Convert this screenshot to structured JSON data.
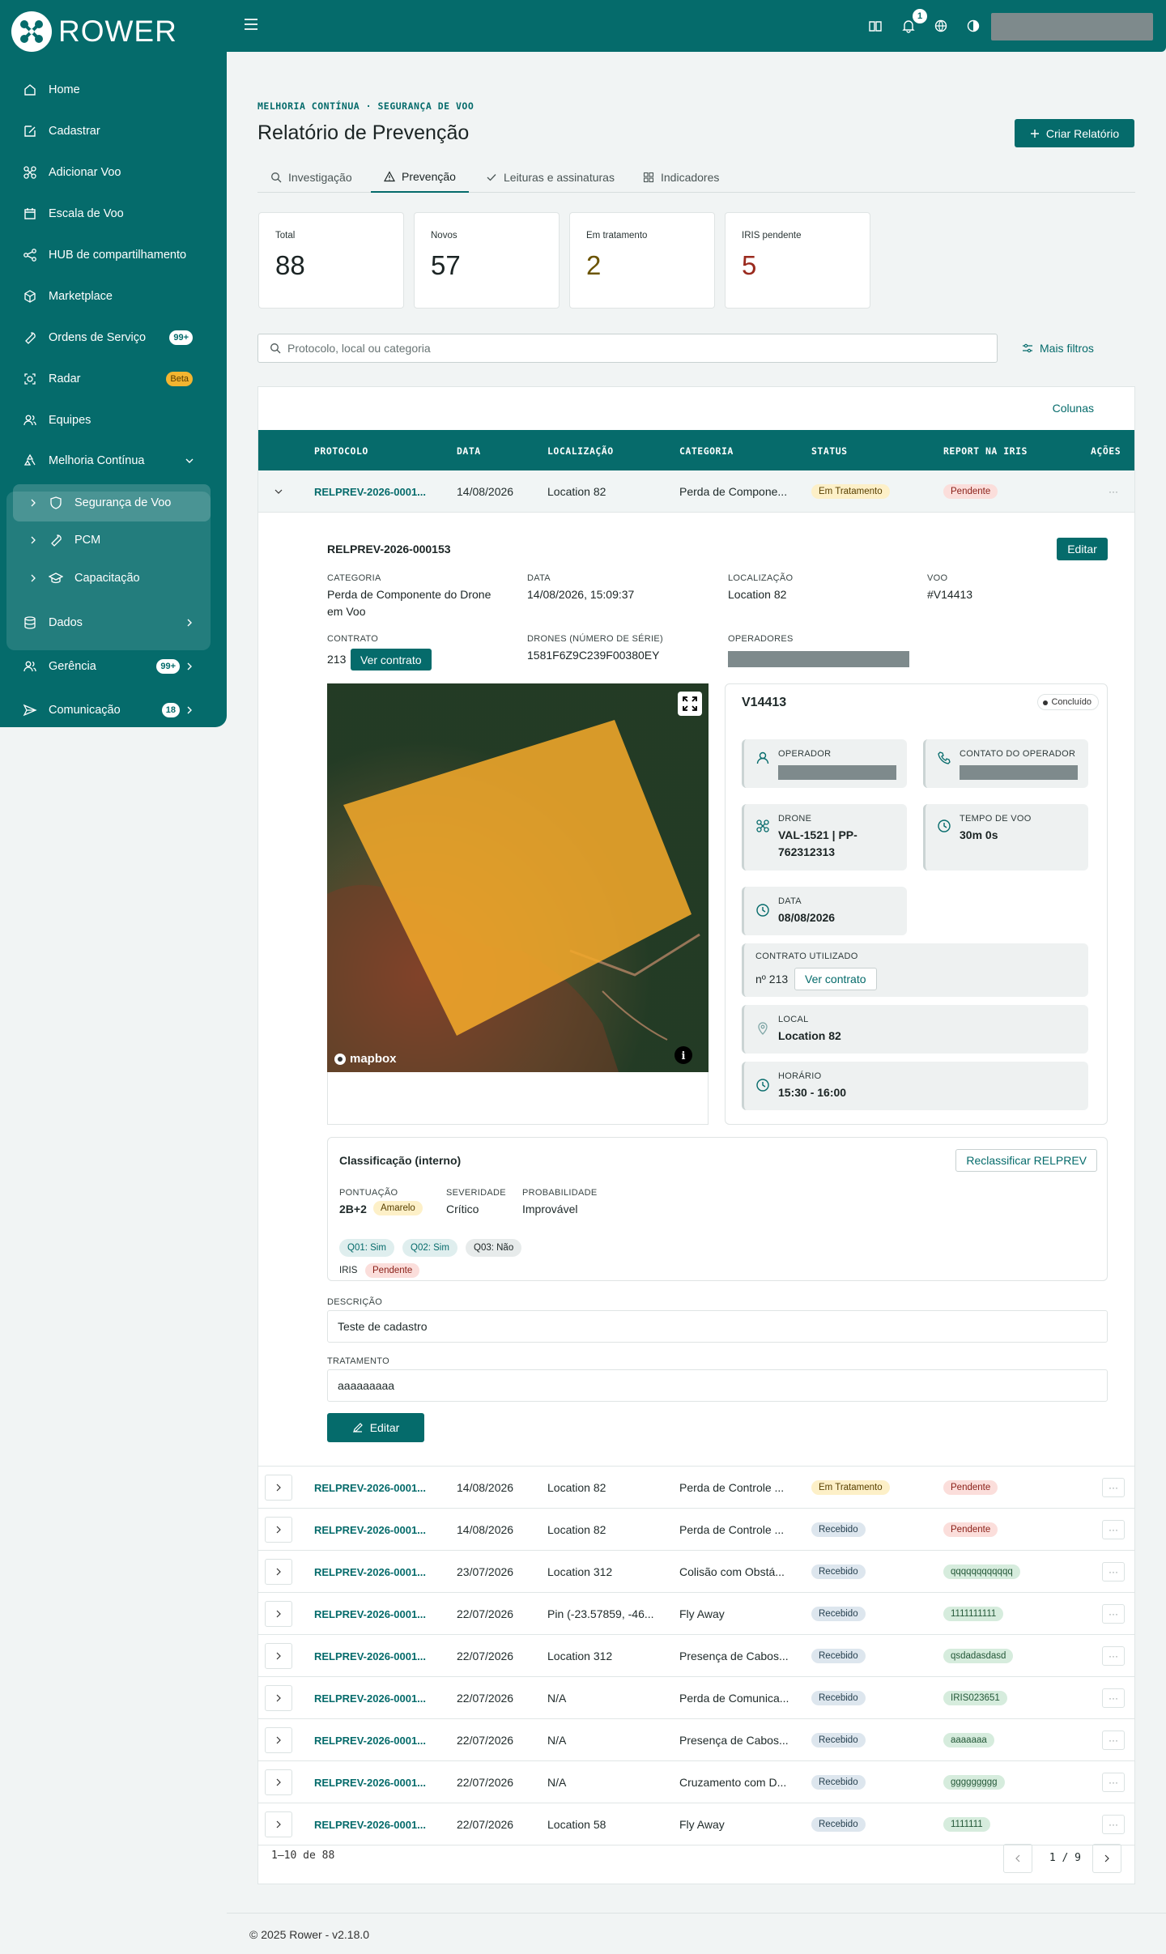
{
  "app": {
    "logo_text": "ROWER",
    "notifications_count": "1"
  },
  "sidebar": {
    "items": [
      {
        "label": "Home"
      },
      {
        "label": "Cadastrar"
      },
      {
        "label": "Adicionar Voo"
      },
      {
        "label": "Escala de Voo"
      },
      {
        "label": "HUB de compartilhamento"
      },
      {
        "label": "Marketplace"
      },
      {
        "label": "Ordens de Serviço",
        "badge": "99+"
      },
      {
        "label": "Radar",
        "badge": "Beta"
      },
      {
        "label": "Equipes"
      },
      {
        "label": "Melhoria Contínua"
      },
      {
        "label": "Dados"
      },
      {
        "label": "Gerência",
        "badge": "99+"
      },
      {
        "label": "Comunicação",
        "badge": "18"
      }
    ],
    "sub_items": [
      {
        "label": "Segurança de Voo"
      },
      {
        "label": "PCM"
      },
      {
        "label": "Capacitação"
      }
    ]
  },
  "header": {
    "breadcrumb": "MELHORIA CONTÍNUA · SEGURANÇA DE VOO",
    "title": "Relatório de Prevenção",
    "create_button": "Criar Relatório"
  },
  "tabs": [
    "Investigação",
    "Prevenção",
    "Leituras e assinaturas",
    "Indicadores"
  ],
  "stats": [
    {
      "label": "Total",
      "value": "88",
      "color": "#1b2424"
    },
    {
      "label": "Novos",
      "value": "57",
      "color": "#1b2424"
    },
    {
      "label": "Em tratamento",
      "value": "2",
      "color": "#6b5400"
    },
    {
      "label": "IRIS pendente",
      "value": "5",
      "color": "#9a2a1e"
    }
  ],
  "search": {
    "placeholder": "Protocolo, local ou categoria",
    "filters_label": "Mais filtros"
  },
  "table": {
    "columns_link": "Colunas",
    "headers": [
      "PROTOCOLO",
      "DATA",
      "LOCALIZAÇÃO",
      "CATEGORIA",
      "STATUS",
      "REPORT NA IRIS",
      "AÇÕES"
    ],
    "expanded_row": {
      "protocol": "RELPREV-2026-0001...",
      "date": "14/08/2026",
      "location": "Location 82",
      "category": "Perda de Compone...",
      "status": "Em Tratamento",
      "iris": "Pendente"
    },
    "rows": [
      {
        "protocol": "RELPREV-2026-0001...",
        "date": "14/08/2026",
        "location": "Location 82",
        "category": "Perda de Controle ...",
        "status": "Em Tratamento",
        "iris": "Pendente"
      },
      {
        "protocol": "RELPREV-2026-0001...",
        "date": "14/08/2026",
        "location": "Location 82",
        "category": "Perda de Controle ...",
        "status": "Recebido",
        "iris": "Pendente"
      },
      {
        "protocol": "RELPREV-2026-0001...",
        "date": "23/07/2026",
        "location": "Location 312",
        "category": "Colisão com Obstá...",
        "status": "Recebido",
        "iris": "qqqqqqqqqqqq"
      },
      {
        "protocol": "RELPREV-2026-0001...",
        "date": "22/07/2026",
        "location": "Pin (-23.57859, -46...",
        "category": "Fly Away",
        "status": "Recebido",
        "iris": "1111111111"
      },
      {
        "protocol": "RELPREV-2026-0001...",
        "date": "22/07/2026",
        "location": "Location 312",
        "category": "Presença de Cabos...",
        "status": "Recebido",
        "iris": "qsdadasdasd"
      },
      {
        "protocol": "RELPREV-2026-0001...",
        "date": "22/07/2026",
        "location": "N/A",
        "category": "Perda de Comunica...",
        "status": "Recebido",
        "iris": "IRIS023651"
      },
      {
        "protocol": "RELPREV-2026-0001...",
        "date": "22/07/2026",
        "location": "N/A",
        "category": "Presença de Cabos...",
        "status": "Recebido",
        "iris": "aaaaaaa"
      },
      {
        "protocol": "RELPREV-2026-0001...",
        "date": "22/07/2026",
        "location": "N/A",
        "category": "Cruzamento com D...",
        "status": "Recebido",
        "iris": "ggggggggg"
      },
      {
        "protocol": "RELPREV-2026-0001...",
        "date": "22/07/2026",
        "location": "Location 58",
        "category": "Fly Away",
        "status": "Recebido",
        "iris": "1111111"
      }
    ],
    "pagination": {
      "info": "1–10 de 88",
      "page": "1 / 9"
    }
  },
  "detail": {
    "protocol": "RELPREV-2026-000153",
    "edit_label": "Editar",
    "category_label": "CATEGORIA",
    "category": "Perda de Componente do Drone em Voo",
    "date_label": "DATA",
    "date": "14/08/2026, 15:09:37",
    "location_label": "LOCALIZAÇÃO",
    "location": "Location 82",
    "flight_label": "VOO",
    "flight": "#V14413",
    "contract_label": "CONTRATO",
    "contract": "213",
    "contract_button": "Ver contrato",
    "drones_label": "DRONES (NÚMERO DE SÉRIE)",
    "drones": "1581F6Z9C239F00380EY",
    "operators_label": "OPERADORES",
    "map_attribution": "mapbox",
    "flight_card": {
      "id": "V14413",
      "status": "Concluído",
      "operator_label": "OPERADOR",
      "operator_contact_label": "CONTATO DO OPERADOR",
      "drone_label": "DRONE",
      "drone": "VAL-1521 | PP-762312313",
      "flight_time_label": "TEMPO DE VOO",
      "flight_time": "30m 0s",
      "date_label": "DATA",
      "date": "08/08/2026",
      "contract_label": "CONTRATO UTILIZADO",
      "contract": "nº 213",
      "contract_button": "Ver contrato",
      "local_label": "LOCAL",
      "local": "Location 82",
      "time_label": "HORÁRIO",
      "time": "15:30 - 16:00"
    },
    "classification": {
      "title": "Classificação (interno)",
      "reclassify_button": "Reclassificar RELPREV",
      "score_label": "PONTUAÇÃO",
      "score": "2B+2",
      "score_badge": "Amarelo",
      "severity_label": "SEVERIDADE",
      "severity": "Crítico",
      "probability_label": "PROBABILIDADE",
      "probability": "Improvável",
      "questions": [
        "Q01: Sim",
        "Q02: Sim",
        "Q03: Não"
      ],
      "iris_label": "IRIS",
      "iris": "Pendente"
    },
    "description_label": "DESCRIÇÃO",
    "description": "Teste de cadastro",
    "treatment_label": "TRATAMENTO",
    "treatment": "aaaaaaaaa",
    "edit_bottom_label": "Editar"
  },
  "footer": {
    "text": "© 2025 Rower - v2.18.0"
  }
}
